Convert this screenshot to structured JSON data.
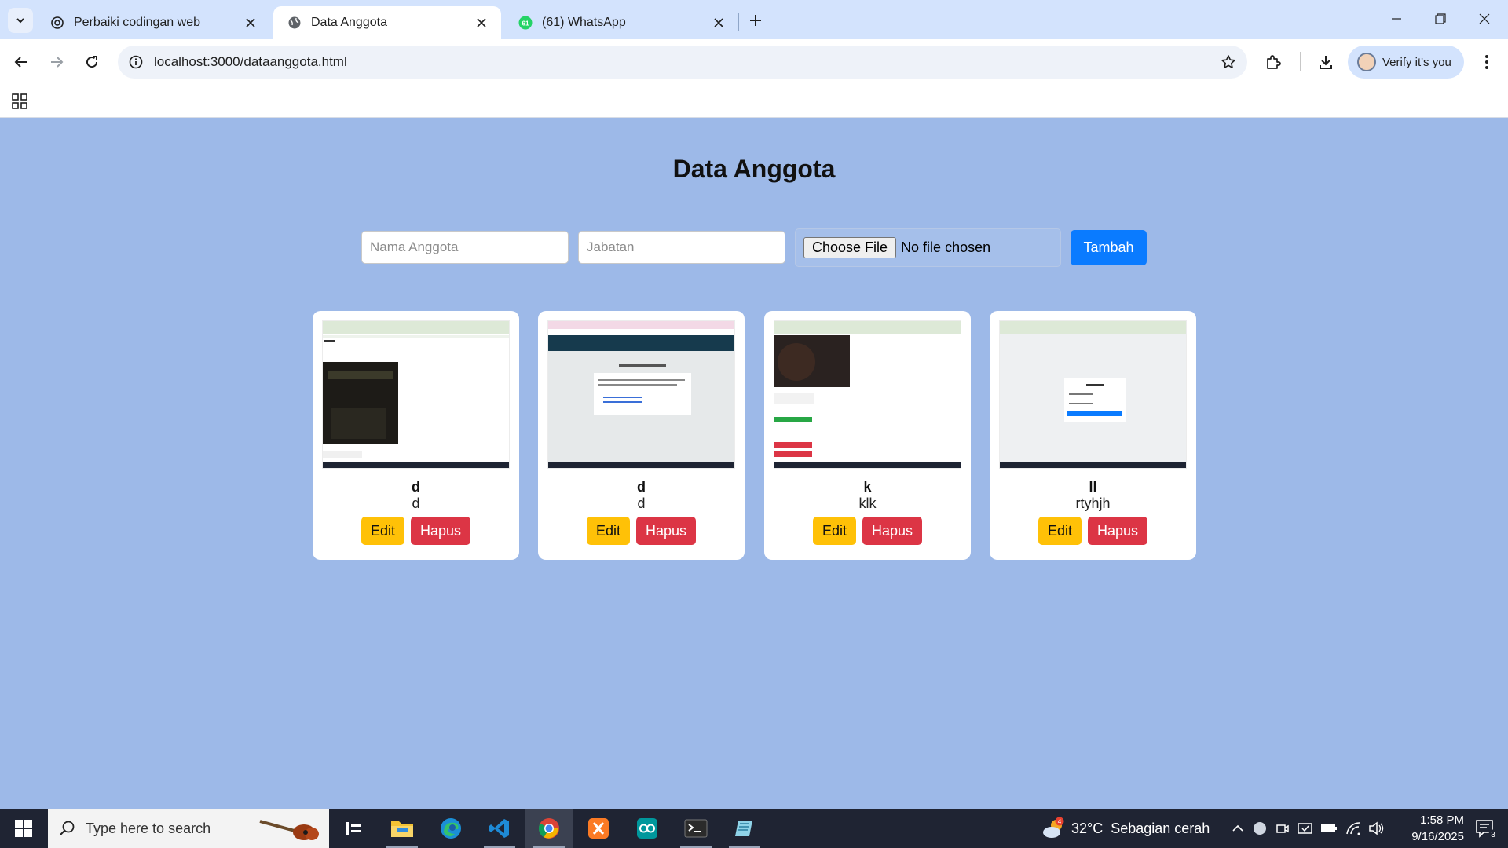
{
  "browser": {
    "tabs": [
      {
        "title": "Perbaiki codingan web",
        "active": false
      },
      {
        "title": "Data Anggota",
        "active": true
      },
      {
        "title": "(61) WhatsApp",
        "active": false,
        "badge": "61"
      }
    ],
    "url": "localhost:3000/dataanggota.html",
    "profile_label": "Verify it's you"
  },
  "page": {
    "title": "Data Anggota",
    "form": {
      "name_placeholder": "Nama Anggota",
      "role_placeholder": "Jabatan",
      "file_button_label": "Choose File",
      "file_status": "No file chosen",
      "submit_label": "Tambah"
    },
    "members": [
      {
        "name": "d",
        "role": "d",
        "edit_label": "Edit",
        "delete_label": "Hapus"
      },
      {
        "name": "d",
        "role": "d",
        "edit_label": "Edit",
        "delete_label": "Hapus"
      },
      {
        "name": "k",
        "role": "klk",
        "edit_label": "Edit",
        "delete_label": "Hapus"
      },
      {
        "name": "ll",
        "role": "rtyhjh",
        "edit_label": "Edit",
        "delete_label": "Hapus"
      }
    ]
  },
  "taskbar": {
    "search_placeholder": "Type here to search",
    "weather_temp": "32°C",
    "weather_desc": "Sebagian cerah",
    "weather_badge": "4",
    "time": "1:58 PM",
    "date": "9/16/2025",
    "notification_count": "3",
    "apps": [
      "task-view",
      "file-explorer",
      "edge",
      "vscode",
      "chrome",
      "xampp",
      "arduino",
      "terminal",
      "notepad"
    ]
  },
  "colors": {
    "page_bg": "#9db9e8",
    "primary": "#0a7bff",
    "edit": "#ffc107",
    "delete": "#dc3545",
    "tabstrip": "#d3e3fd"
  }
}
